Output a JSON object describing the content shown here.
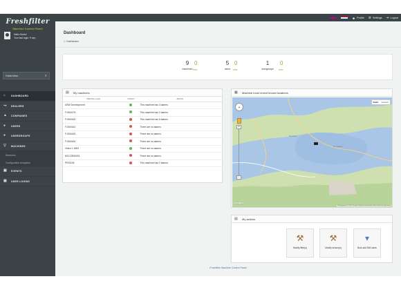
{
  "brand": {
    "name": "Freshfilter",
    "subtitle": "Machine Control Panel"
  },
  "topbar": {
    "profile": "Profile",
    "settings": "Settings",
    "logout": "Logout"
  },
  "user": {
    "name": "Hallo Guido!",
    "last_login": "Your last login: 9 sep"
  },
  "guide_select": {
    "value": "Guido Mars"
  },
  "nav": [
    {
      "label": "DASHBOARD",
      "icon": "home-icon",
      "active": true
    },
    {
      "label": "DEALERS",
      "icon": "dealer-icon"
    },
    {
      "label": "COMPANIES",
      "icon": "company-icon"
    },
    {
      "label": "USERS",
      "icon": "user-icon"
    },
    {
      "label": "USERGROUPS",
      "icon": "users-icon"
    },
    {
      "label": "MACHINES",
      "icon": "filter-icon"
    },
    {
      "label": "EVENTS",
      "icon": "events-icon"
    },
    {
      "label": "USER LOGINS",
      "icon": "logins-icon"
    }
  ],
  "nav_sub": {
    "machines": "Machines",
    "config": "Configuration templates"
  },
  "header": {
    "title": "Dashboard",
    "breadcrumb": "Dashboard"
  },
  "stats": [
    {
      "value": "9",
      "label": "machines",
      "new_value": "0",
      "new_label": "new"
    },
    {
      "value": "5",
      "label": "users",
      "new_value": "0",
      "new_label": "new"
    },
    {
      "value": "1",
      "label": "usergroups",
      "new_value": "0",
      "new_label": "new"
    }
  ],
  "machines_panel": {
    "title": "My machines",
    "columns": [
      "Machine name",
      "Online?",
      "Alarms"
    ],
    "rows": [
      {
        "name": "ASW Development",
        "online": true,
        "alarms": "This machine has 3 alarms"
      },
      {
        "name": "F1504175",
        "online": true,
        "alarms": "This machine has 2 alarms"
      },
      {
        "name": "F1504160",
        "online": false,
        "alarms": "This machine has 8 alarms"
      },
      {
        "name": "F1504161",
        "online": false,
        "alarms": "There are no alarms"
      },
      {
        "name": "F1504163",
        "online": false,
        "alarms": "There are no alarms"
      },
      {
        "name": "F1504164",
        "online": false,
        "alarms": "There are no alarms"
      },
      {
        "name": "Video 1.1563",
        "online": true,
        "alarms": "There are no alarms"
      },
      {
        "name": "MCCZE60001",
        "online": false,
        "alarms": "There are no alarms"
      },
      {
        "name": "PROD05",
        "online": false,
        "alarms": "This machine has 2 alarms"
      }
    ]
  },
  "map_panel": {
    "title": "Machine most recent known locations",
    "map_type": [
      "Kaart",
      "Satelliet"
    ],
    "brand": "Google",
    "attribution": "Kaartgegevens ©2015 Google   Gebruiksvoorwaarden   Een kaartfout rapporteren",
    "label_a": "Flevoland",
    "label_b": "De Gulden"
  },
  "actions_panel": {
    "title": "My actions",
    "buttons": [
      {
        "label": "Modify filter(s)",
        "icon": "tools-icon"
      },
      {
        "label": "Modify sensor(s)",
        "icon": "tools-icon"
      },
      {
        "label": "Bulk add SIM cards",
        "icon": "sim-icon"
      }
    ]
  },
  "footer": "Freshfilter Machine Control Panel",
  "colors": {
    "sidebar": "#3b4347",
    "accent": "#82b431",
    "online": "#5cb85c",
    "offline": "#d9534f"
  }
}
